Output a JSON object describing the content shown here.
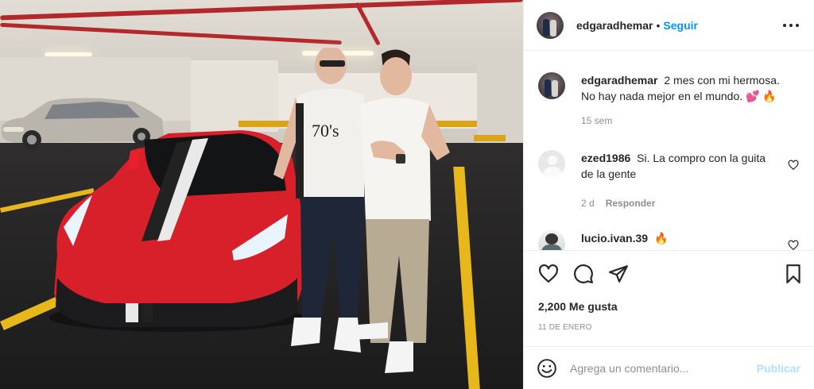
{
  "post": {
    "author": "edgaradhemar",
    "follow_label": "Seguir",
    "separator": "•",
    "image_alt": "Dos hombres junto a un Ferrari rojo en un estacionamiento"
  },
  "caption": {
    "username": "edgaradhemar",
    "text": "2 mes con mi hermosa. No hay nada mejor en el mundo. 💕 🔥",
    "age": "15 sem"
  },
  "comments": [
    {
      "username": "ezed1986",
      "text": "Si. La compro con la guita de la gente",
      "age": "2 d",
      "reply_label": "Responder"
    },
    {
      "username": "lucio.ivan.39",
      "text": "🔥"
    }
  ],
  "stats": {
    "likes": "2,200 Me gusta",
    "date": "11 DE ENERO"
  },
  "composer": {
    "placeholder": "Agrega un comentario...",
    "publish_label": "Publicar"
  },
  "icons": [
    "more-options-icon",
    "heart-icon",
    "comment-icon",
    "share-icon",
    "bookmark-icon",
    "emoji-icon"
  ],
  "colors": {
    "accent": "#0095f6",
    "accent_disabled": "#b2dffc",
    "muted": "#8e8e8e",
    "text": "#262626"
  }
}
